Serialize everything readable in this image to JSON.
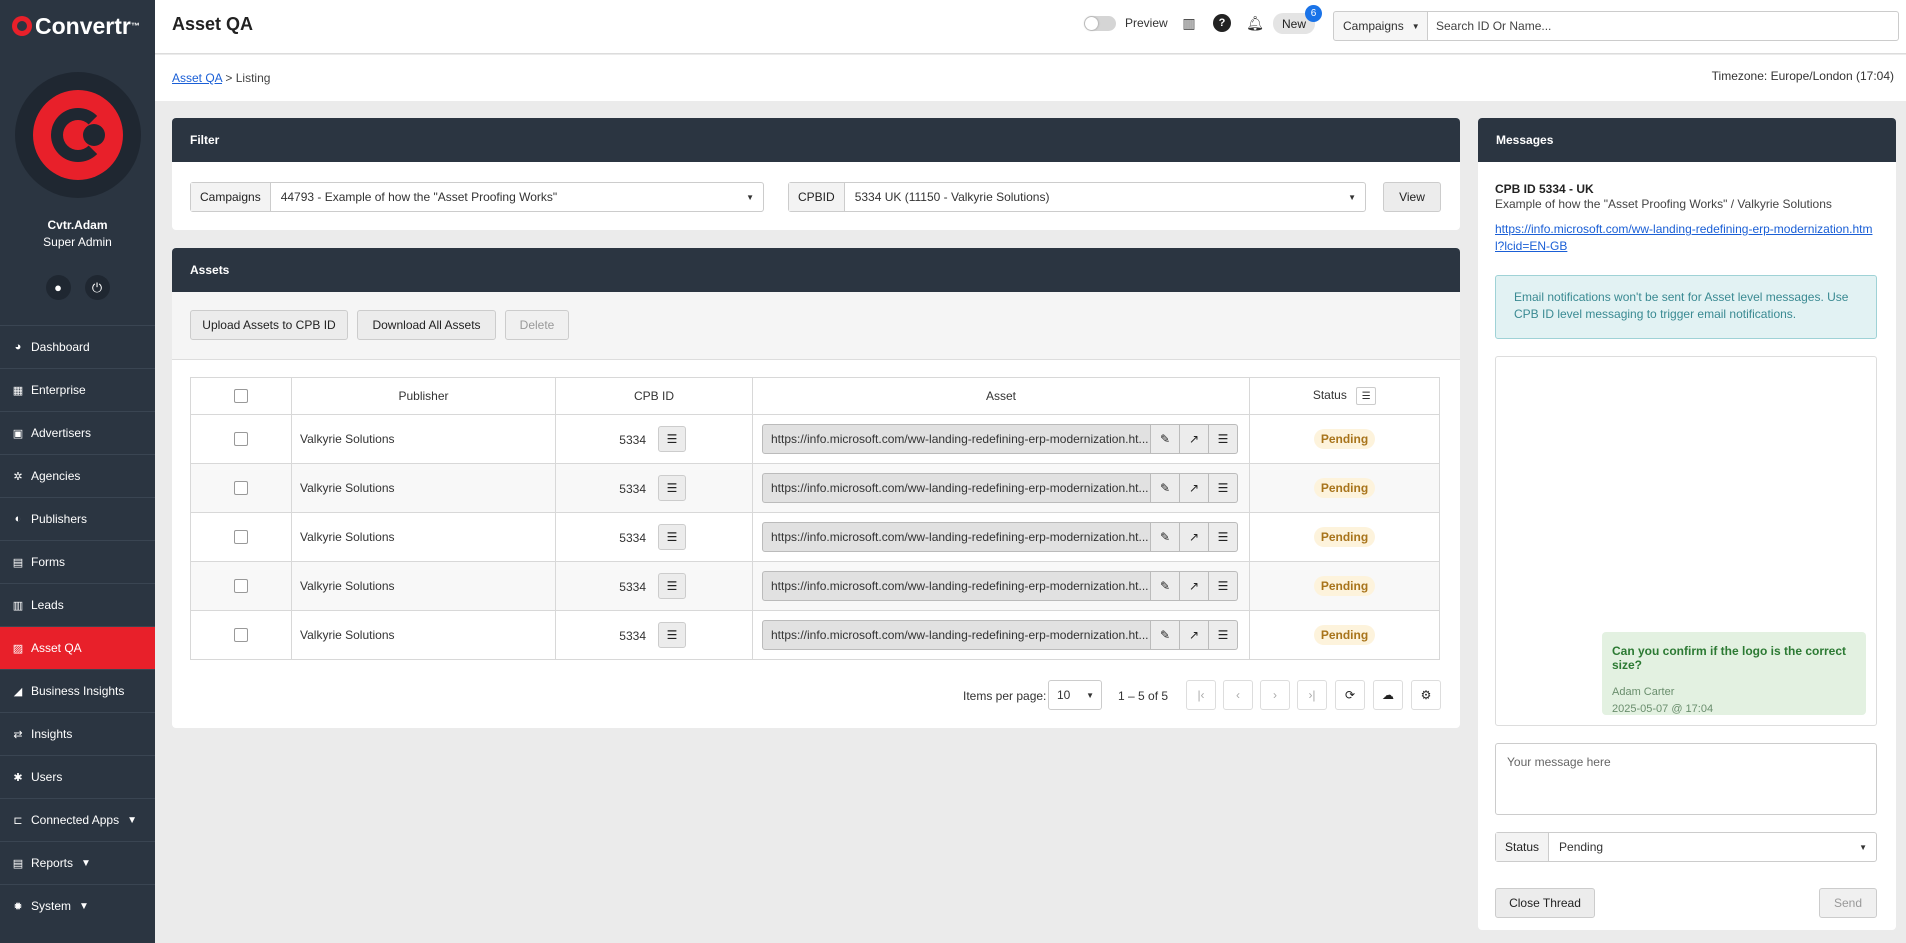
{
  "brand": {
    "name": "Convertr",
    "tm": "™",
    "accent": "#e8202a",
    "sidebar_bg": "#2b3541"
  },
  "user": {
    "name": "Cvtr.Adam",
    "role": "Super Admin"
  },
  "nav": [
    {
      "label": "Dashboard",
      "icon": "dashboard-icon",
      "glyph": "◕",
      "expandable": false,
      "active": false
    },
    {
      "label": "Enterprise",
      "icon": "enterprise-icon",
      "glyph": "▦",
      "expandable": false,
      "active": false
    },
    {
      "label": "Advertisers",
      "icon": "advertisers-icon",
      "glyph": "▣",
      "expandable": false,
      "active": false
    },
    {
      "label": "Agencies",
      "icon": "agencies-icon",
      "glyph": "✲",
      "expandable": false,
      "active": false
    },
    {
      "label": "Publishers",
      "icon": "publishers-icon",
      "glyph": "◐",
      "expandable": false,
      "active": false
    },
    {
      "label": "Forms",
      "icon": "forms-icon",
      "glyph": "▤",
      "expandable": false,
      "active": false
    },
    {
      "label": "Leads",
      "icon": "leads-icon",
      "glyph": "▥",
      "expandable": false,
      "active": false
    },
    {
      "label": "Asset QA",
      "icon": "asset-qa-icon",
      "glyph": "▨",
      "expandable": false,
      "active": true
    },
    {
      "label": "Business Insights",
      "icon": "business-insights-icon",
      "glyph": "◢",
      "expandable": false,
      "active": false
    },
    {
      "label": "Insights",
      "icon": "insights-icon",
      "glyph": "⇄",
      "expandable": false,
      "active": false
    },
    {
      "label": "Users",
      "icon": "users-icon",
      "glyph": "✱",
      "expandable": false,
      "active": false
    },
    {
      "label": "Connected Apps",
      "icon": "connected-apps-icon",
      "glyph": "⊏",
      "expandable": true,
      "active": false
    },
    {
      "label": "Reports",
      "icon": "reports-icon",
      "glyph": "▤",
      "expandable": true,
      "active": false
    },
    {
      "label": "System",
      "icon": "system-icon",
      "glyph": "✹",
      "expandable": true,
      "active": false
    }
  ],
  "header": {
    "title": "Asset QA",
    "preview_label": "Preview",
    "new_label": "New",
    "new_count": "6",
    "campaign_select": "Campaigns",
    "search_placeholder": "Search ID Or Name..."
  },
  "breadcrumb": {
    "root": "Asset QA",
    "separator": ">",
    "current": "Listing"
  },
  "timezone": "Timezone: Europe/London (17:04)",
  "filter": {
    "title": "Filter",
    "campaigns_label": "Campaigns",
    "campaigns_value": "44793 - Example of how the \"Asset Proofing Works\"",
    "cpbid_label": "CPBID",
    "cpbid_value": "5334 UK (11150 - Valkyrie Solutions)",
    "view_label": "View"
  },
  "assets": {
    "title": "Assets",
    "upload_label": "Upload Assets to CPB ID",
    "download_label": "Download All Assets",
    "delete_label": "Delete",
    "columns": [
      "Publisher",
      "CPB ID",
      "Asset",
      "Status"
    ],
    "rows": [
      {
        "publisher": "Valkyrie Solutions",
        "cpb_id": "5334",
        "asset": "https://info.microsoft.com/ww-landing-redefining-erp-modernization.ht...",
        "status": "Pending"
      },
      {
        "publisher": "Valkyrie Solutions",
        "cpb_id": "5334",
        "asset": "https://info.microsoft.com/ww-landing-redefining-erp-modernization.ht...",
        "status": "Pending"
      },
      {
        "publisher": "Valkyrie Solutions",
        "cpb_id": "5334",
        "asset": "https://info.microsoft.com/ww-landing-redefining-erp-modernization.ht...",
        "status": "Pending"
      },
      {
        "publisher": "Valkyrie Solutions",
        "cpb_id": "5334",
        "asset": "https://info.microsoft.com/ww-landing-redefining-erp-modernization.ht...",
        "status": "Pending"
      },
      {
        "publisher": "Valkyrie Solutions",
        "cpb_id": "5334",
        "asset": "https://info.microsoft.com/ww-landing-redefining-erp-modernization.ht...",
        "status": "Pending"
      }
    ],
    "pagination": {
      "items_per_page_label": "Items per page:",
      "items_per_page": "10",
      "range": "1 – 5 of 5"
    }
  },
  "messages": {
    "title": "Messages",
    "cpb_line": "CPB ID  5334  - UK",
    "description": "Example of how the \"Asset Proofing Works\" / Valkyrie Solutions",
    "link": "https://info.microsoft.com/ww-landing-redefining-erp-modernization.html?lcid=EN-GB",
    "notice": "Email notifications won't be sent for Asset level messages. Use CPB ID level messaging to trigger email notifications.",
    "thread": [
      {
        "text": "Can you confirm if the logo is the correct size?",
        "author": "Adam Carter",
        "time": "2025-05-07 @ 17:04"
      }
    ],
    "input_placeholder": "Your message here",
    "status_label": "Status",
    "status_value": "Pending",
    "close_label": "Close Thread",
    "send_label": "Send"
  }
}
